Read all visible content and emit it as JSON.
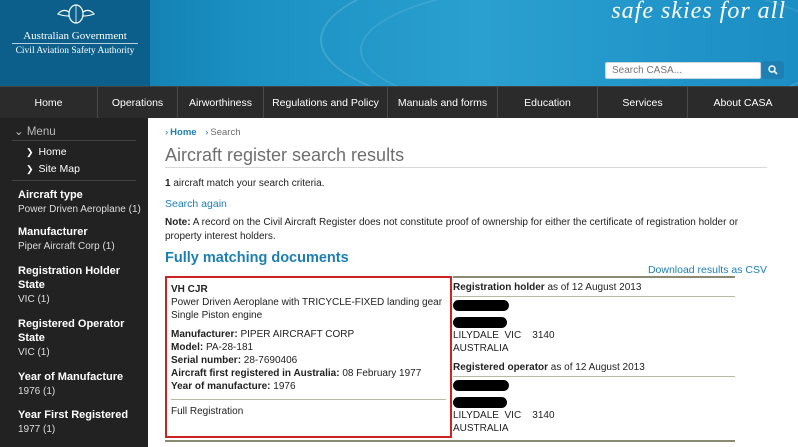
{
  "header": {
    "gov_name": "Australian Government",
    "authority_name": "Civil Aviation Safety Authority",
    "tagline": "safe skies for all",
    "search_placeholder": "Search CASA...",
    "search_button_icon": "search-icon"
  },
  "nav": {
    "items": [
      {
        "label": "Home"
      },
      {
        "label": "Operations"
      },
      {
        "label": "Airworthiness"
      },
      {
        "label": "Regulations and Policy"
      },
      {
        "label": "Manuals and forms"
      },
      {
        "label": "Education"
      },
      {
        "label": "Services"
      },
      {
        "label": "About CASA"
      }
    ]
  },
  "sidebar": {
    "menu_label": "Menu",
    "links": [
      {
        "label": "Home"
      },
      {
        "label": "Site Map"
      }
    ],
    "facets": [
      {
        "title": "Aircraft type",
        "value": "Power Driven Aeroplane (1)"
      },
      {
        "title": "Manufacturer",
        "value": "Piper Aircraft Corp (1)"
      },
      {
        "title": "Registration Holder State",
        "value": "VIC (1)"
      },
      {
        "title": "Registered Operator State",
        "value": "VIC (1)"
      },
      {
        "title": "Year of Manufacture",
        "value": "1976 (1)"
      },
      {
        "title": "Year First Registered",
        "value": "1977 (1)"
      }
    ]
  },
  "main": {
    "breadcrumb": {
      "home": "Home",
      "current": "Search"
    },
    "title": "Aircraft register search results",
    "match_count": "1",
    "match_text": " aircraft match your search criteria.",
    "search_again": "Search again",
    "note_label": "Note:",
    "note_text": " A record on the Civil Aircraft Register does not constitute proof of ownership for either the certificate of registration holder or property interest holders.",
    "section_title": "Fully matching documents",
    "csv_link": "Download results as CSV",
    "record": {
      "registration": "VH CJR",
      "description": "Power Driven Aeroplane with TRICYCLE-FIXED landing gear",
      "engine": "Single Piston engine",
      "manufacturer_label": "Manufacturer:",
      "manufacturer": " PIPER AIRCRAFT CORP",
      "model_label": "Model:",
      "model": " PA-28-181",
      "serial_label": "Serial number:",
      "serial": " 28-7690406",
      "first_reg_label": "Aircraft first registered in Australia:",
      "first_reg": " 08 February 1977",
      "year_label": "Year of manufacture:",
      "year": " 1976",
      "status": "Full Registration"
    },
    "holder": {
      "label": "Registration holder",
      "as_of": " as of 12 August 2013",
      "city_line": "LILYDALE  VIC    3140",
      "country": "AUSTRALIA"
    },
    "operator": {
      "label": "Registered operator",
      "as_of": " as of 12 August 2013",
      "city_line": "LILYDALE  VIC    3140",
      "country": "AUSTRALIA"
    }
  }
}
